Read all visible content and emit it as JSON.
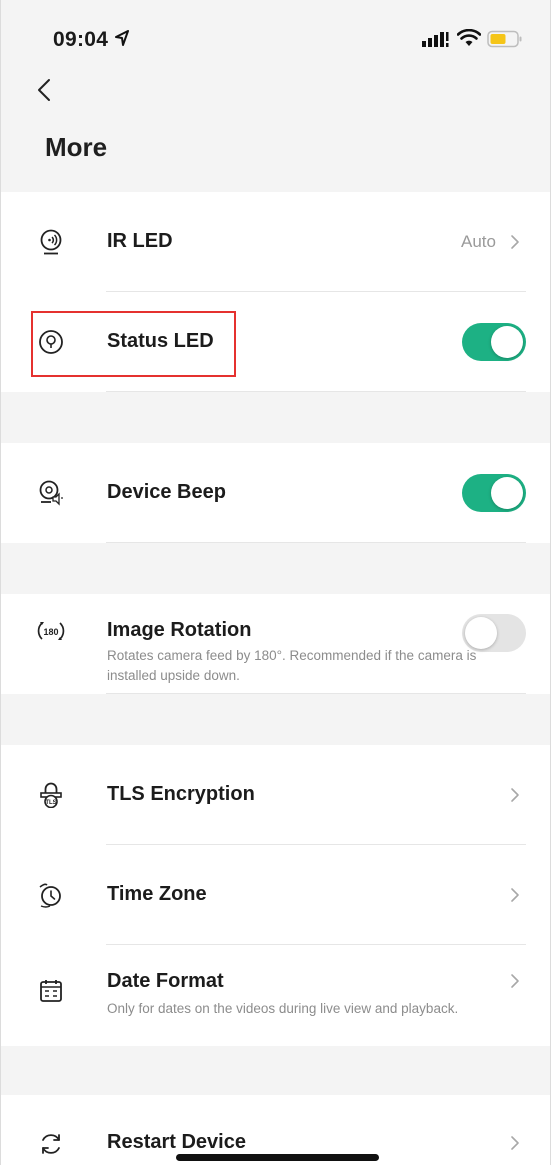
{
  "status_bar": {
    "time": "09:04",
    "battery_color": "#f5c518"
  },
  "header": {
    "back_icon": "chevron-left-icon",
    "title": "More"
  },
  "settings": {
    "ir_led": {
      "label": "IR LED",
      "value": "Auto",
      "icon": "ir-led-icon"
    },
    "status_led": {
      "label": "Status LED",
      "enabled": true,
      "icon": "status-led-icon"
    },
    "device_beep": {
      "label": "Device Beep",
      "enabled": true,
      "icon": "device-beep-icon"
    },
    "image_rotation": {
      "label": "Image Rotation",
      "description": "Rotates camera feed by 180°. Recommended if the camera is installed upside down.",
      "enabled": false,
      "icon": "rotate-180-icon",
      "icon_text": "180"
    },
    "tls_encryption": {
      "label": "TLS Encryption",
      "icon": "lock-tls-icon",
      "icon_text": "TLS"
    },
    "time_zone": {
      "label": "Time Zone",
      "icon": "globe-clock-icon"
    },
    "date_format": {
      "label": "Date Format",
      "description": "Only for dates on the videos during live view and playback.",
      "icon": "calendar-icon"
    },
    "restart_device": {
      "label": "Restart Device",
      "icon": "restart-icon"
    }
  },
  "colors": {
    "toggle_on": "#1db184",
    "toggle_off": "#e4e4e4",
    "highlight": "#e5312f",
    "background": "#f4f4f4"
  }
}
